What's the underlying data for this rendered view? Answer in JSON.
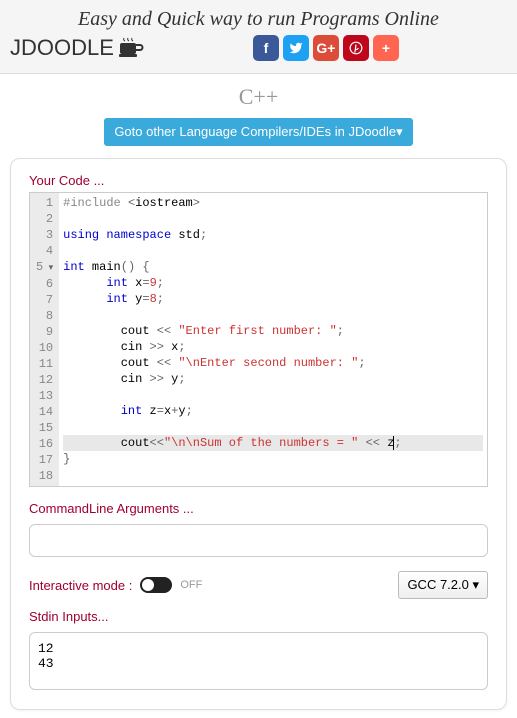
{
  "header": {
    "tagline": "Easy and Quick way to run Programs Online",
    "logo": "JDOODLE"
  },
  "lang": "C++",
  "goto_btn": "Goto other Language Compilers/IDEs in JDoodle▾",
  "labels": {
    "your_code": "Your Code ...",
    "cmd_args": "CommandLine Arguments ...",
    "int_mode": "Interactive mode :",
    "off": "OFF",
    "stdin": "Stdin Inputs..."
  },
  "compiler": "GCC 7.2.0 ▾",
  "args_value": "",
  "stdin_value": "12\n43",
  "code_lines": [
    {
      "n": "1",
      "tokens": [
        [
          "pp",
          "#include"
        ],
        [
          "id",
          " "
        ],
        [
          "op",
          "<"
        ],
        [
          "id",
          "iostream"
        ],
        [
          "op",
          ">"
        ]
      ]
    },
    {
      "n": "2",
      "tokens": []
    },
    {
      "n": "3",
      "tokens": [
        [
          "kw",
          "using"
        ],
        [
          "id",
          " "
        ],
        [
          "kw",
          "namespace"
        ],
        [
          "id",
          " std"
        ],
        [
          "op",
          ";"
        ]
      ]
    },
    {
      "n": "4",
      "tokens": []
    },
    {
      "n": "5",
      "fold": true,
      "tokens": [
        [
          "kw",
          "int"
        ],
        [
          "id",
          " main"
        ],
        [
          "op",
          "() {"
        ]
      ]
    },
    {
      "n": "6",
      "tokens": [
        [
          "id",
          "      "
        ],
        [
          "kw",
          "int"
        ],
        [
          "id",
          " x"
        ],
        [
          "op",
          "="
        ],
        [
          "num",
          "9"
        ],
        [
          "op",
          ";"
        ]
      ]
    },
    {
      "n": "7",
      "tokens": [
        [
          "id",
          "      "
        ],
        [
          "kw",
          "int"
        ],
        [
          "id",
          " y"
        ],
        [
          "op",
          "="
        ],
        [
          "num",
          "8"
        ],
        [
          "op",
          ";"
        ]
      ]
    },
    {
      "n": "8",
      "tokens": []
    },
    {
      "n": "9",
      "tokens": [
        [
          "id",
          "        cout "
        ],
        [
          "op",
          "<<"
        ],
        [
          "id",
          " "
        ],
        [
          "str",
          "\"Enter first number: \""
        ],
        [
          "op",
          ";"
        ]
      ]
    },
    {
      "n": "10",
      "tokens": [
        [
          "id",
          "        cin "
        ],
        [
          "op",
          ">>"
        ],
        [
          "id",
          " x"
        ],
        [
          "op",
          ";"
        ]
      ]
    },
    {
      "n": "11",
      "tokens": [
        [
          "id",
          "        cout "
        ],
        [
          "op",
          "<<"
        ],
        [
          "id",
          " "
        ],
        [
          "str",
          "\"\\nEnter second number: \""
        ],
        [
          "op",
          ";"
        ]
      ]
    },
    {
      "n": "12",
      "tokens": [
        [
          "id",
          "        cin "
        ],
        [
          "op",
          ">>"
        ],
        [
          "id",
          " y"
        ],
        [
          "op",
          ";"
        ]
      ]
    },
    {
      "n": "13",
      "tokens": []
    },
    {
      "n": "14",
      "tokens": [
        [
          "id",
          "        "
        ],
        [
          "kw",
          "int"
        ],
        [
          "id",
          " z"
        ],
        [
          "op",
          "="
        ],
        [
          "id",
          "x"
        ],
        [
          "op",
          "+"
        ],
        [
          "id",
          "y"
        ],
        [
          "op",
          ";"
        ]
      ]
    },
    {
      "n": "15",
      "tokens": []
    },
    {
      "n": "16",
      "hl": true,
      "cursor_at": 5,
      "tokens": [
        [
          "id",
          "        cout"
        ],
        [
          "op",
          "<<"
        ],
        [
          "str",
          "\"\\n\\nSum of the numbers = \""
        ],
        [
          "id",
          " "
        ],
        [
          "op",
          "<<"
        ],
        [
          "id",
          " z"
        ],
        [
          "op",
          ";"
        ]
      ]
    },
    {
      "n": "17",
      "tokens": [
        [
          "op",
          "}"
        ]
      ]
    },
    {
      "n": "18",
      "tokens": []
    }
  ]
}
